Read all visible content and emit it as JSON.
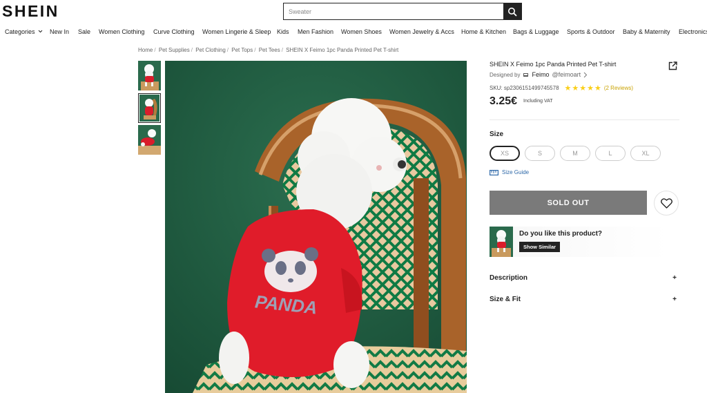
{
  "header": {
    "logo": "SHEIN",
    "search_placeholder": "Sweater"
  },
  "nav": {
    "items": [
      "Categories",
      "New In",
      "Sale",
      "Women Clothing",
      "Curve Clothing",
      "Women Lingerie & Sleep",
      "Kids",
      "Men Fashion",
      "Women Shoes",
      "Women Jewelry & Accs",
      "Home & Kitchen",
      "Bags & Luggage",
      "Sports & Outdoor",
      "Baby & Maternity",
      "Electronics"
    ]
  },
  "breadcrumb": [
    "Home",
    "Pet Supplies",
    "Pet Clothing",
    "Pet Tops",
    "Pet Tees",
    "SHEIN X Feimo 1pc Panda Printed Pet T-shirt"
  ],
  "product": {
    "title": "SHEIN X Feimo 1pc Panda Printed Pet T-shirt",
    "designed_by_label": "Designed by",
    "designer_name": "Feimo",
    "designer_handle": "@feimoart",
    "sku": "SKU: sp2306151499745578",
    "stars": "★★★★★",
    "rating": 5,
    "reviews": "(2 Reviews)",
    "price": "3.25€",
    "vat": "Including VAT",
    "size_title": "Size",
    "sizes": [
      "XS",
      "S",
      "M",
      "L",
      "XL"
    ],
    "selected_size": "XS",
    "size_guide": "Size Guide",
    "soldout_label": "SOLD OUT",
    "similar_question": "Do you like this product?",
    "similar_button": "Show Similar",
    "description_label": "Description",
    "size_fit_label": "Size & Fit",
    "expand_symbol": "+",
    "panda_text": "PANDA"
  },
  "colors": {
    "background_green": "#1e5b40",
    "shirt_red": "#e01c2a",
    "soldout_gray": "#7a7a7a",
    "star_yellow": "#facf19",
    "link_blue": "#2d68a8"
  }
}
